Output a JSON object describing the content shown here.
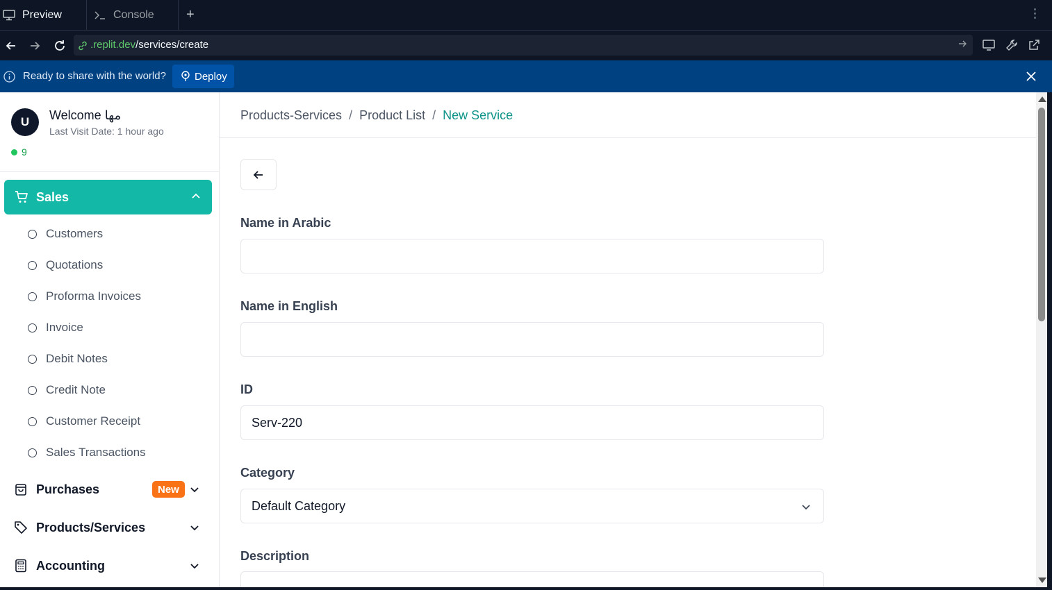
{
  "tabs": {
    "preview_label": "Preview",
    "console_label": "Console"
  },
  "url": {
    "host": ".replit.dev",
    "path": "/services/create"
  },
  "deploy_bar": {
    "message": "Ready to share with the world?",
    "button_label": "Deploy"
  },
  "user": {
    "avatar_initial": "U",
    "welcome": "Welcome مها",
    "last_visit": "Last Visit Date: 1 hour ago",
    "online_count": "9"
  },
  "sidebar": {
    "active_group": "Sales",
    "sales_items": [
      "Customers",
      "Quotations",
      "Proforma Invoices",
      "Invoice",
      "Debit Notes",
      "Credit Note",
      "Customer Receipt",
      "Sales Transactions"
    ],
    "groups": [
      {
        "label": "Purchases",
        "badge": "New"
      },
      {
        "label": "Products/Services"
      },
      {
        "label": "Accounting"
      }
    ]
  },
  "breadcrumb": {
    "items": [
      "Products-Services",
      "Product List"
    ],
    "current": "New Service"
  },
  "form": {
    "name_ar_label": "Name in Arabic",
    "name_ar_value": "",
    "name_en_label": "Name in English",
    "name_en_value": "",
    "id_label": "ID",
    "id_value": "Serv-220",
    "category_label": "Category",
    "category_value": "Default Category",
    "description_label": "Description"
  },
  "colors": {
    "accent": "#14b8a6",
    "deploy_bar": "#004182",
    "badge_new": "#f97316"
  }
}
